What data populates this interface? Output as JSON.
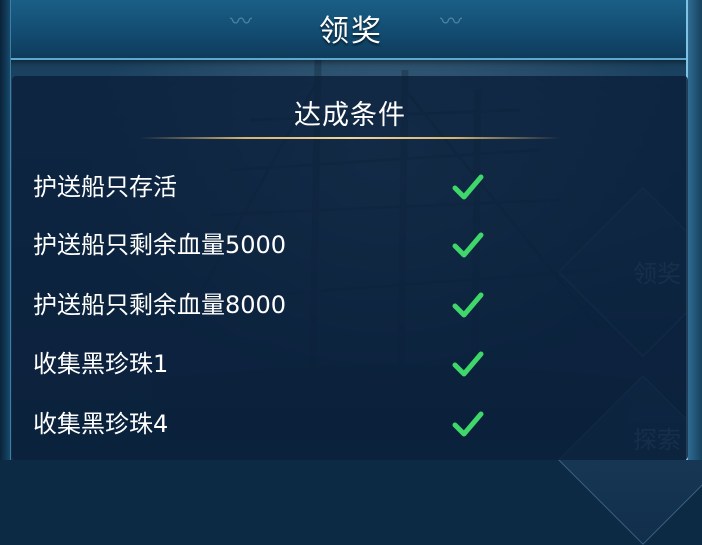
{
  "header": {
    "title": "领奖"
  },
  "panel": {
    "title": "达成条件",
    "conditions": [
      {
        "label": "护送船只存活",
        "completed": true
      },
      {
        "label": "护送船只剩余血量5000",
        "completed": true
      },
      {
        "label": "护送船只剩余血量8000",
        "completed": true
      },
      {
        "label": "收集黑珍珠1",
        "completed": true
      },
      {
        "label": "收集黑珍珠4",
        "completed": true
      }
    ]
  },
  "side_buttons": [
    {
      "label": "领奖"
    },
    {
      "label": "探索"
    }
  ],
  "colors": {
    "check": "#3fd66a",
    "divider_gold": "#d7b36e",
    "header_blue": "#134c72"
  }
}
